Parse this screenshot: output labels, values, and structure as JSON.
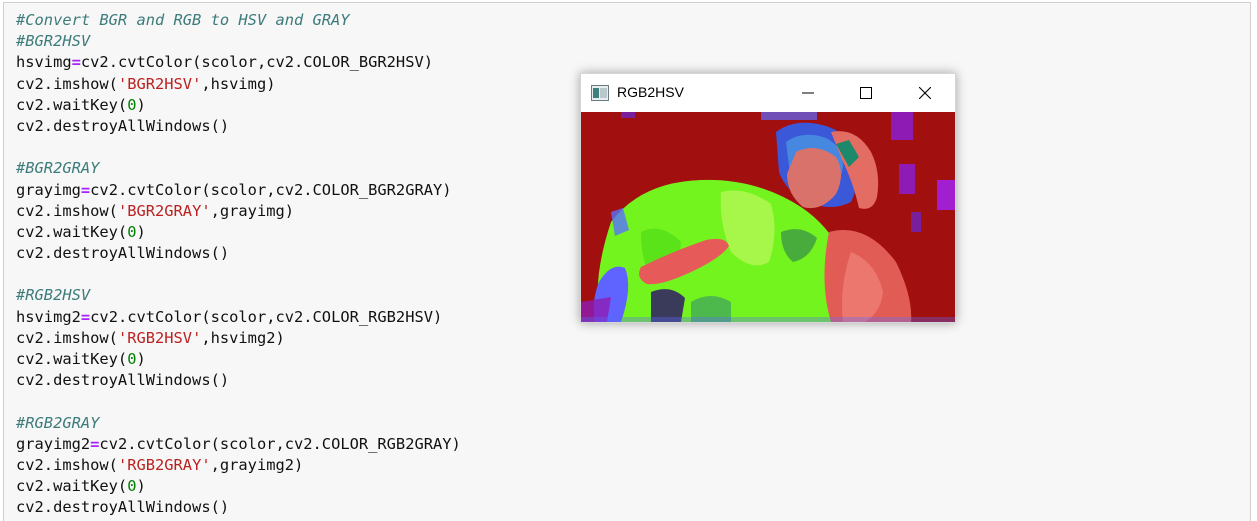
{
  "code": {
    "lines": [
      [
        {
          "t": "#Convert BGR and RGB to HSV and GRAY",
          "k": "c"
        }
      ],
      [
        {
          "t": "#BGR2HSV",
          "k": "c"
        }
      ],
      [
        {
          "t": "hsvimg",
          "k": ""
        },
        {
          "t": "=",
          "k": "o"
        },
        {
          "t": "cv2.cvtColor(scolor,cv2.COLOR_BGR2HSV)",
          "k": ""
        }
      ],
      [
        {
          "t": "cv2.imshow(",
          "k": ""
        },
        {
          "t": "'BGR2HSV'",
          "k": "s"
        },
        {
          "t": ",hsvimg)",
          "k": ""
        }
      ],
      [
        {
          "t": "cv2.waitKey(",
          "k": ""
        },
        {
          "t": "0",
          "k": "n"
        },
        {
          "t": ")",
          "k": ""
        }
      ],
      [
        {
          "t": "cv2.destroyAllWindows()",
          "k": ""
        }
      ],
      [],
      [
        {
          "t": "#BGR2GRAY",
          "k": "c"
        }
      ],
      [
        {
          "t": "grayimg",
          "k": ""
        },
        {
          "t": "=",
          "k": "o"
        },
        {
          "t": "cv2.cvtColor(scolor,cv2.COLOR_BGR2GRAY)",
          "k": ""
        }
      ],
      [
        {
          "t": "cv2.imshow(",
          "k": ""
        },
        {
          "t": "'BGR2GRAY'",
          "k": "s"
        },
        {
          "t": ",grayimg)",
          "k": ""
        }
      ],
      [
        {
          "t": "cv2.waitKey(",
          "k": ""
        },
        {
          "t": "0",
          "k": "n"
        },
        {
          "t": ")",
          "k": ""
        }
      ],
      [
        {
          "t": "cv2.destroyAllWindows()",
          "k": ""
        }
      ],
      [],
      [
        {
          "t": "#RGB2HSV",
          "k": "c"
        }
      ],
      [
        {
          "t": "hsvimg2",
          "k": ""
        },
        {
          "t": "=",
          "k": "o"
        },
        {
          "t": "cv2.cvtColor(scolor,cv2.COLOR_RGB2HSV)",
          "k": ""
        }
      ],
      [
        {
          "t": "cv2.imshow(",
          "k": ""
        },
        {
          "t": "'RGB2HSV'",
          "k": "s"
        },
        {
          "t": ",hsvimg2)",
          "k": ""
        }
      ],
      [
        {
          "t": "cv2.waitKey(",
          "k": ""
        },
        {
          "t": "0",
          "k": "n"
        },
        {
          "t": ")",
          "k": ""
        }
      ],
      [
        {
          "t": "cv2.destroyAllWindows()",
          "k": ""
        }
      ],
      [],
      [
        {
          "t": "#RGB2GRAY",
          "k": "c"
        }
      ],
      [
        {
          "t": "grayimg2",
          "k": ""
        },
        {
          "t": "=",
          "k": "o"
        },
        {
          "t": "cv2.cvtColor(scolor,cv2.COLOR_RGB2GRAY)",
          "k": ""
        }
      ],
      [
        {
          "t": "cv2.imshow(",
          "k": ""
        },
        {
          "t": "'RGB2GRAY'",
          "k": "s"
        },
        {
          "t": ",grayimg2)",
          "k": ""
        }
      ],
      [
        {
          "t": "cv2.waitKey(",
          "k": ""
        },
        {
          "t": "0",
          "k": "n"
        },
        {
          "t": ")",
          "k": ""
        }
      ],
      [
        {
          "t": "cv2.destroyAllWindows()",
          "k": ""
        }
      ]
    ]
  },
  "window": {
    "title": "RGB2HSV",
    "app_icon": "opencv-window-icon",
    "controls": [
      "minimize-icon",
      "maximize-icon",
      "close-icon"
    ],
    "image_colors": {
      "background": "#9c0c0c",
      "figure": "#e2544f",
      "shirt": "#7ef21c",
      "accent": "#9b1ab8"
    }
  }
}
